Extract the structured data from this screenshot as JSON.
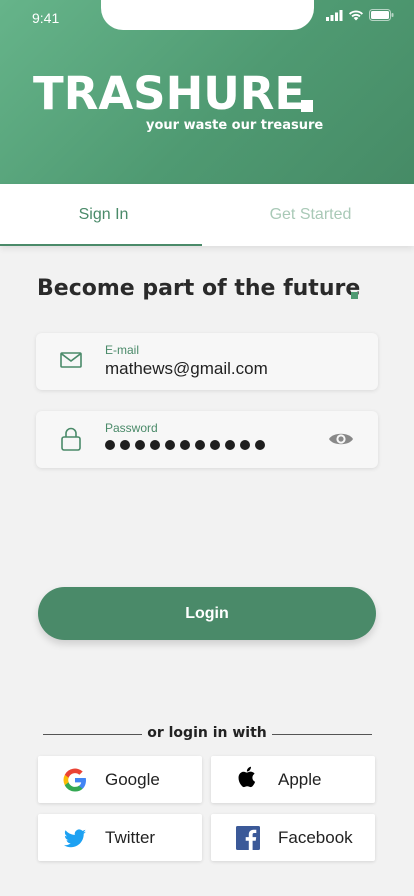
{
  "status_bar": {
    "time": "9:41"
  },
  "brand": {
    "name": "TRASHURE",
    "tagline": "your waste our treasure"
  },
  "tabs": [
    {
      "label": "Sign In",
      "active": true
    },
    {
      "label": "Get Started",
      "active": false
    }
  ],
  "heading": "Become part of the future",
  "form": {
    "email": {
      "label": "E-mail",
      "value": "mathews@gmail.com",
      "icon": "mail-icon"
    },
    "password": {
      "label": "Password",
      "masked_length": 11,
      "icon": "lock-icon",
      "toggle_icon": "eye-icon"
    }
  },
  "login_button": "Login",
  "divider_text": "or login in  with",
  "social": [
    {
      "label": "Google",
      "icon": "google-icon"
    },
    {
      "label": "Apple",
      "icon": "apple-icon"
    },
    {
      "label": "Twitter",
      "icon": "twitter-icon"
    },
    {
      "label": "Facebook",
      "icon": "facebook-icon"
    }
  ],
  "colors": {
    "accent": "#4a8a69",
    "hero_start": "#66b48a",
    "hero_end": "#468b66",
    "inactive_tab": "#a9c9b7"
  }
}
